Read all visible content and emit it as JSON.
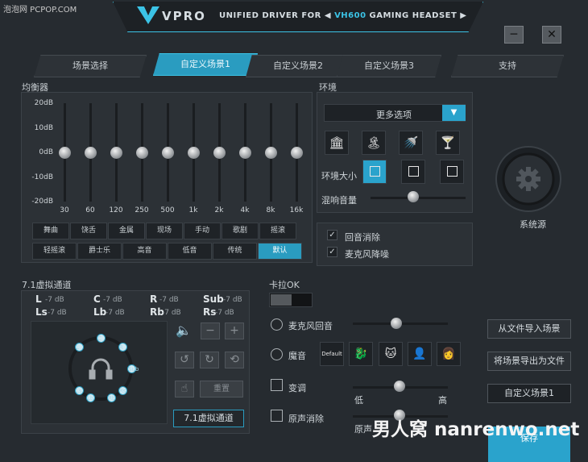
{
  "watermark_top": "泡泡网 PCPOP.COM",
  "header": {
    "brand": "VPRO",
    "subtitle_prefix": "UNIFIED DRIVER FOR",
    "model": "VH600",
    "subtitle_suffix": "GAMING HEADSET",
    "prev_arrow": "◀",
    "next_arrow": "▶",
    "minimize_label": "─",
    "close_label": "✕"
  },
  "tabs": [
    {
      "label": "场景选择",
      "active": false
    },
    {
      "label": "自定义场景1",
      "active": true
    },
    {
      "label": "自定义场景2",
      "active": false
    },
    {
      "label": "自定义场景3",
      "active": false
    },
    {
      "label": "支持",
      "active": false
    }
  ],
  "equalizer": {
    "title": "均衡器",
    "y_labels": [
      "20dB",
      "10dB",
      "0dB",
      "-10dB",
      "-20dB"
    ],
    "bands": [
      "30",
      "60",
      "120",
      "250",
      "500",
      "1k",
      "2k",
      "4k",
      "8k",
      "16k"
    ],
    "gains_db": [
      0,
      0,
      0,
      0,
      0,
      0,
      0,
      0,
      0,
      0
    ],
    "presets_row1": [
      "舞曲",
      "饶舌",
      "金属",
      "现场",
      "手动",
      "歌剧",
      "摇滚"
    ],
    "presets_row2": [
      "轻摇滚",
      "爵士乐",
      "高音",
      "低音",
      "传统",
      "默认"
    ],
    "active_preset": "默认"
  },
  "environment": {
    "title": "环境",
    "dropdown_value": "更多选项",
    "dropdown_arrow": "▼",
    "icons": [
      "museum-icon",
      "island-icon",
      "shower-icon",
      "cocktail-icon"
    ],
    "icon_glyphs": [
      "🏛",
      "🏝",
      "🚿",
      "🍸"
    ],
    "size_label": "环境大小",
    "sizes": [
      "small",
      "medium",
      "large"
    ],
    "selected_size": "small",
    "reverb_label": "混响音量",
    "reverb_level": 0.45
  },
  "noise": {
    "echo_cancel": {
      "label": "回音消除",
      "checked": true
    },
    "mic_denoise": {
      "label": "麦克风降噪",
      "checked": true
    }
  },
  "system_source": {
    "label": "系统源"
  },
  "side_buttons": {
    "import": "从文件导入场景",
    "export": "将场景导出为文件",
    "current_scene": "自定义场景1",
    "save": "保存"
  },
  "virtual71": {
    "title": "7.1虚拟通道",
    "channels_row1": [
      {
        "name": "L",
        "db": "-7 dB"
      },
      {
        "name": "C",
        "db": "-7 dB"
      },
      {
        "name": "R",
        "db": "-7 dB"
      },
      {
        "name": "Sub",
        "db": "-7 dB"
      }
    ],
    "channels_row2": [
      {
        "name": "Ls",
        "db": "-7 dB"
      },
      {
        "name": "Lb",
        "db": "-7 dB"
      },
      {
        "name": "Rb",
        "db": "-7 dB"
      },
      {
        "name": "Rs",
        "db": "-7 dB"
      }
    ],
    "speaker_labels": [
      "C",
      "L",
      "R",
      "Sub",
      "Rs",
      "Rb",
      "Lb",
      "Ls"
    ],
    "button_label": "7.1虚拟通道",
    "disabled_button_label": "重置"
  },
  "karaoke": {
    "title": "卡拉OK",
    "mic_echo_label": "麦克风回音",
    "voice_label": "魔音",
    "voice_presets": [
      "Default",
      "dragon-icon",
      "cat-icon",
      "man-icon",
      "woman-icon"
    ],
    "voice_default_label": "Default",
    "pitch_label": "变调",
    "pitch_low": "低",
    "pitch_high": "高",
    "vocal_remove_label": "原声消除",
    "vocal_remove_sub": "原声"
  },
  "watermark_bottom": "男人窝 nanrenwo.net"
}
